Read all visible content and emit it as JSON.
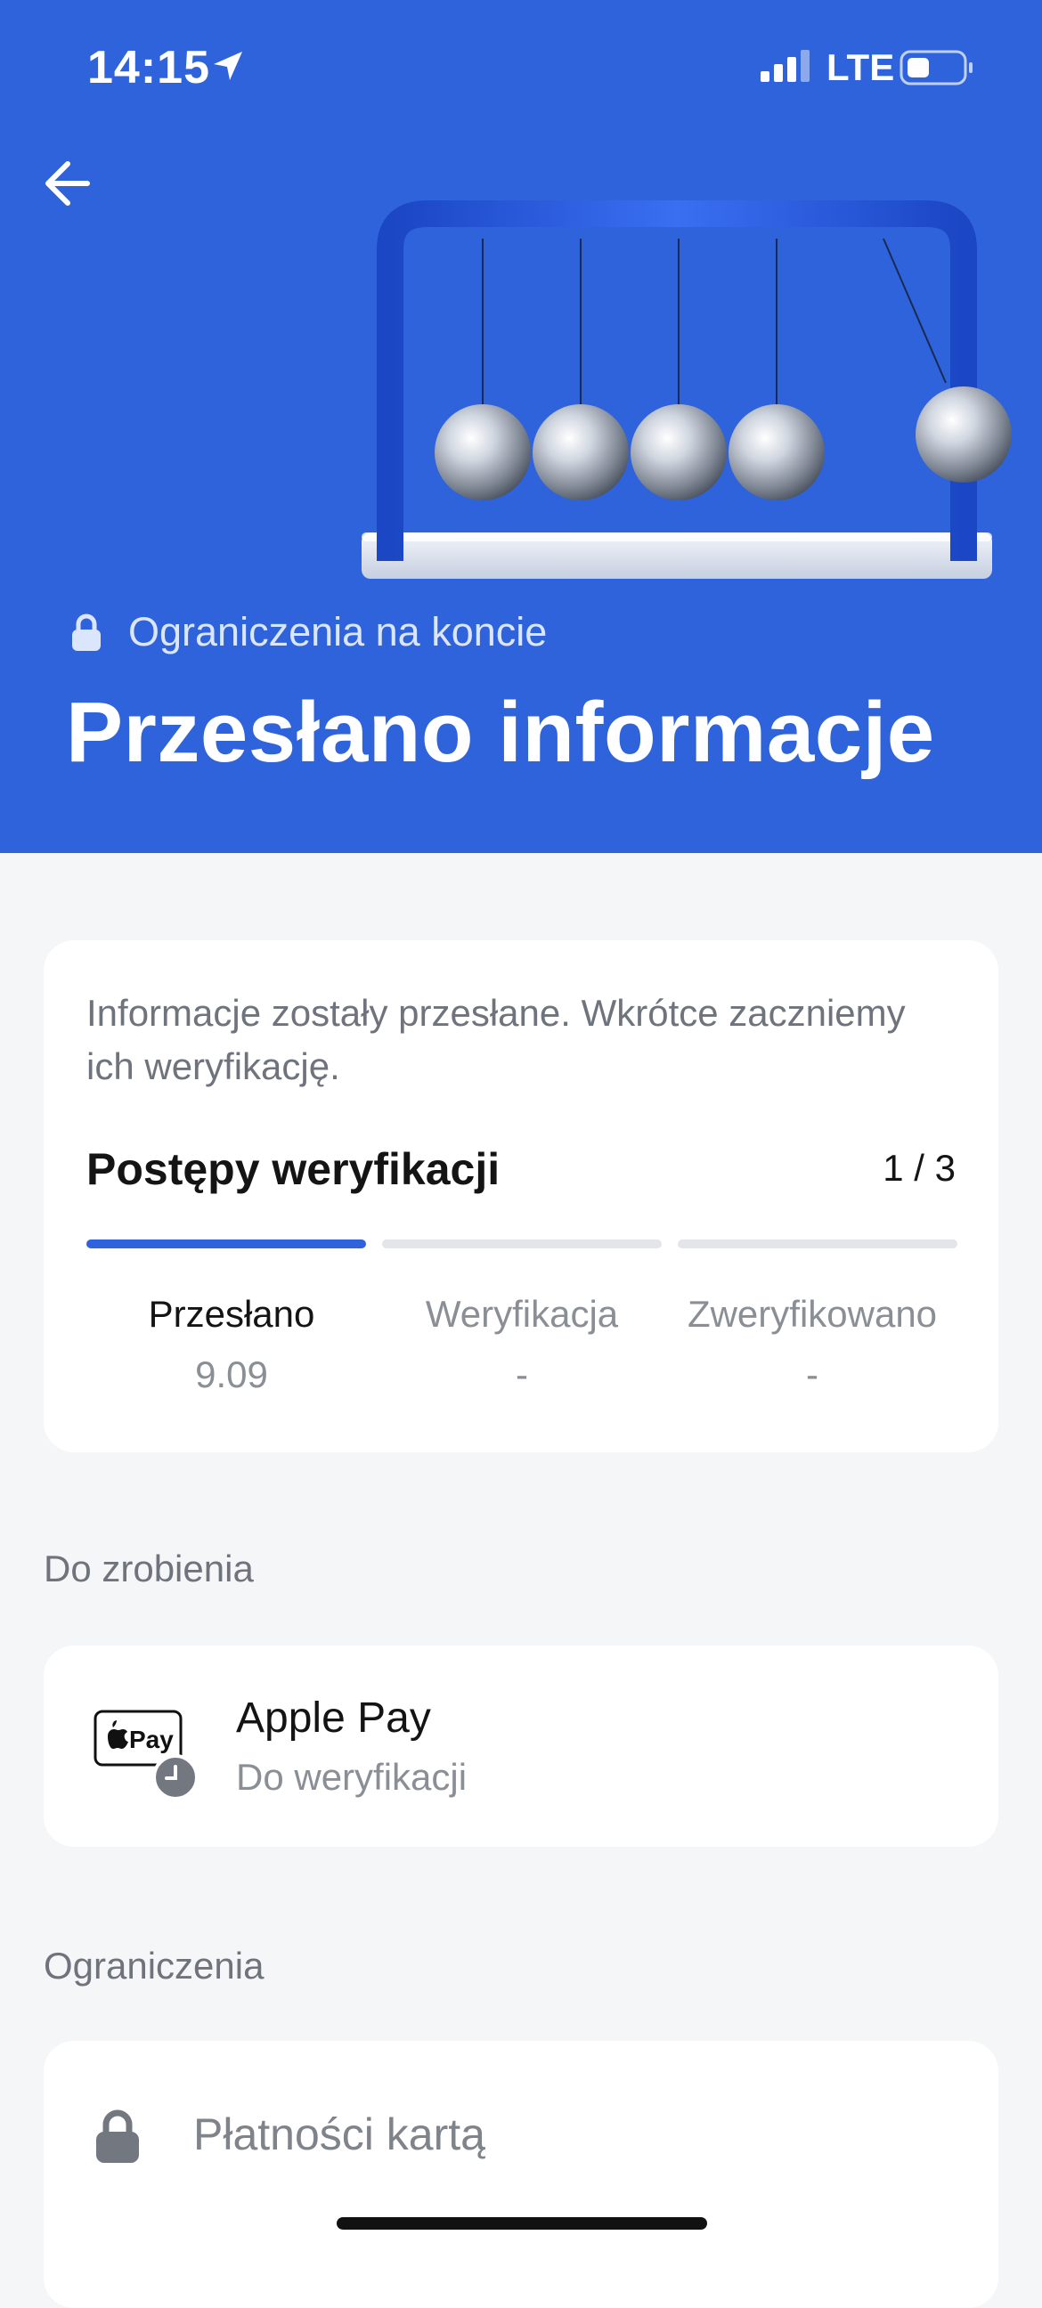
{
  "status_bar": {
    "time": "14:15",
    "network": "LTE"
  },
  "icons": {
    "back": "arrow-left-icon",
    "location": "location-arrow-icon",
    "signal": "cellular-signal-icon",
    "battery": "battery-icon",
    "lock": "lock-icon",
    "apple_pay": "apple-pay-icon",
    "clock": "clock-icon"
  },
  "hero": {
    "tag": "Ograniczenia na koncie",
    "title": "Przesłano informacje"
  },
  "verification": {
    "description": "Informacje zostały przesłane. Wkrótce zaczniemy ich weryfikację.",
    "heading": "Postępy weryfikacji",
    "count": "1 / 3",
    "progress": 0.333,
    "steps": [
      {
        "label": "Przesłano",
        "value": "9.09"
      },
      {
        "label": "Weryfikacja",
        "value": "-"
      },
      {
        "label": "Zweryfikowano",
        "value": "-"
      }
    ]
  },
  "todo": {
    "section_label": "Do zrobienia",
    "item": {
      "title": "Apple Pay",
      "subtitle": "Do weryfikacji",
      "badge_text": "Pay"
    }
  },
  "limits": {
    "section_label": "Ograniczenia",
    "items": [
      {
        "label": "Płatności kartą"
      }
    ]
  },
  "colors": {
    "brand_blue": "#2e63dc",
    "background": "#f5f6f7",
    "card": "#ffffff",
    "muted_text": "#8a8e95"
  }
}
